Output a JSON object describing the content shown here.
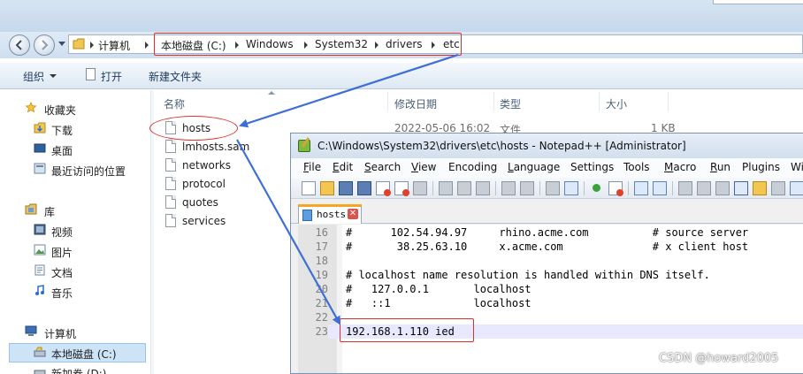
{
  "explorer": {
    "address": {
      "breadcrumbs": [
        "计算机",
        "本地磁盘 (C:)",
        "Windows",
        "System32",
        "drivers",
        "etc"
      ]
    },
    "toolbar": {
      "organize": "组织",
      "open": "打开",
      "new_folder": "新建文件夹"
    },
    "sidebar": {
      "favorites": "收藏夹",
      "downloads": "下载",
      "desktop": "桌面",
      "recent": "最近访问的位置",
      "libraries": "库",
      "videos": "视频",
      "pictures": "图片",
      "documents": "文档",
      "music": "音乐",
      "computer": "计算机",
      "local_disk": "本地磁盘 (C:)",
      "new_volume": "新加卷 (D:)"
    },
    "columns": {
      "name": "名称",
      "date": "修改日期",
      "type": "类型",
      "size": "大小"
    },
    "files": [
      {
        "name": "hosts",
        "date": "2022-05-06 16:02",
        "type": "文件",
        "size": "1 KB"
      },
      {
        "name": "lmhosts.sam"
      },
      {
        "name": "networks"
      },
      {
        "name": "protocol"
      },
      {
        "name": "quotes"
      },
      {
        "name": "services"
      }
    ]
  },
  "notepad": {
    "title": "C:\\Windows\\System32\\drivers\\etc\\hosts - Notepad++ [Administrator]",
    "menu": [
      {
        "u": "F",
        "rest": "ile"
      },
      {
        "u": "E",
        "rest": "dit"
      },
      {
        "u": "S",
        "rest": "earch"
      },
      {
        "u": "V",
        "rest": "iew"
      },
      {
        "u": "",
        "rest": "Encoding"
      },
      {
        "u": "L",
        "rest": "anguage"
      },
      {
        "u": "",
        "rest": "Settings"
      },
      {
        "u": "",
        "rest": "Tools"
      },
      {
        "u": "M",
        "rest": "acro"
      },
      {
        "u": "R",
        "rest": "un"
      },
      {
        "u": "",
        "rest": "Plugins"
      },
      {
        "u": "",
        "rest": "Wi"
      }
    ],
    "tab": {
      "label": "hosts",
      "close": "✕"
    },
    "lines": [
      {
        "n": "16",
        "text": "#      102.54.94.97     rhino.acme.com          # source server"
      },
      {
        "n": "17",
        "text": "#       38.25.63.10     x.acme.com              # x client host"
      },
      {
        "n": "18",
        "text": ""
      },
      {
        "n": "19",
        "text": "# localhost name resolution is handled within DNS itself."
      },
      {
        "n": "20",
        "text": "#   127.0.0.1       localhost"
      },
      {
        "n": "21",
        "text": "#   ::1             localhost"
      },
      {
        "n": "22",
        "text": ""
      },
      {
        "n": "23",
        "text": "192.168.1.110 ied"
      }
    ]
  },
  "watermark": "CSDN @howard2005",
  "colors": {
    "annotation_red": "#e0302a",
    "annotation_arrow_blue": "#3d6fd6",
    "current_line": "#e8e8ff",
    "selection": "#cde4f7"
  }
}
